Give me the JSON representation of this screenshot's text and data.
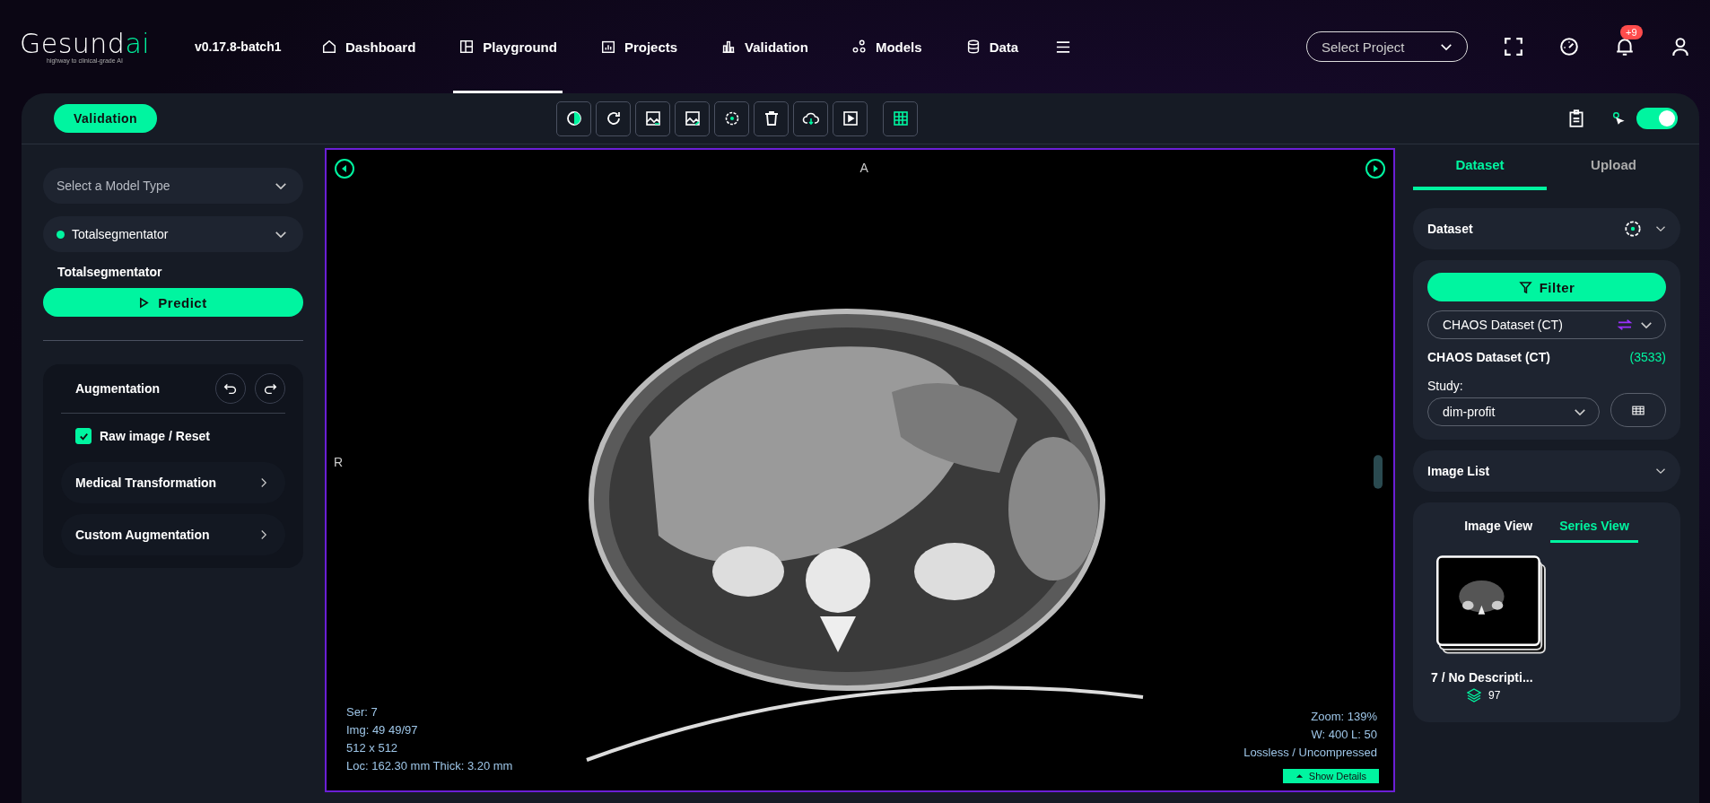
{
  "header": {
    "logo": {
      "name": "Gesund",
      "accent": "ai",
      "tagline": "highway to clinical-grade AI"
    },
    "version": "v0.17.8-batch1",
    "nav": [
      {
        "label": "Dashboard",
        "selected": false
      },
      {
        "label": "Playground",
        "selected": true
      },
      {
        "label": "Projects",
        "selected": false
      },
      {
        "label": "Validation",
        "selected": false
      },
      {
        "label": "Models",
        "selected": false
      },
      {
        "label": "Data",
        "selected": false
      }
    ],
    "project_select": {
      "placeholder": "Select Project"
    },
    "notifications": {
      "badge": "+9"
    }
  },
  "toolbar": {
    "mode_button": "Validation",
    "toggle": {
      "on": true
    }
  },
  "left": {
    "model_type": {
      "placeholder": "Select a Model Type"
    },
    "model": {
      "value": "Totalsegmentator"
    },
    "model_title": "Totalsegmentator",
    "predict": "Predict",
    "augmentation": {
      "title": "Augmentation",
      "raw": {
        "label": "Raw image / Reset",
        "checked": true
      },
      "sections": [
        "Medical Transformation",
        "Custom Augmentation"
      ]
    }
  },
  "viewer": {
    "top_label": "A",
    "left_label": "R",
    "info_left": [
      "Ser: 7",
      "Img: 49 49/97",
      "512 x 512",
      "Loc: 162.30 mm Thick: 3.20 mm"
    ],
    "info_right": [
      "Zoom: 139%",
      "W: 400 L: 50",
      "Lossless / Uncompressed"
    ],
    "show_details": "Show Details"
  },
  "right": {
    "tabs": [
      {
        "label": "Dataset",
        "selected": true
      },
      {
        "label": "Upload",
        "selected": false
      }
    ],
    "dataset_section": "Dataset",
    "filter": "Filter",
    "dataset_select": "CHAOS Dataset (CT)",
    "dataset_name": "CHAOS Dataset (CT)",
    "dataset_count": "(3533)",
    "study_label": "Study:",
    "study_value": "dim-profit",
    "image_list": "Image List",
    "view_tabs": [
      {
        "label": "Image View",
        "selected": false
      },
      {
        "label": "Series View",
        "selected": true
      }
    ],
    "series": [
      {
        "title": "7 / No Descripti...",
        "count": "97"
      }
    ]
  }
}
